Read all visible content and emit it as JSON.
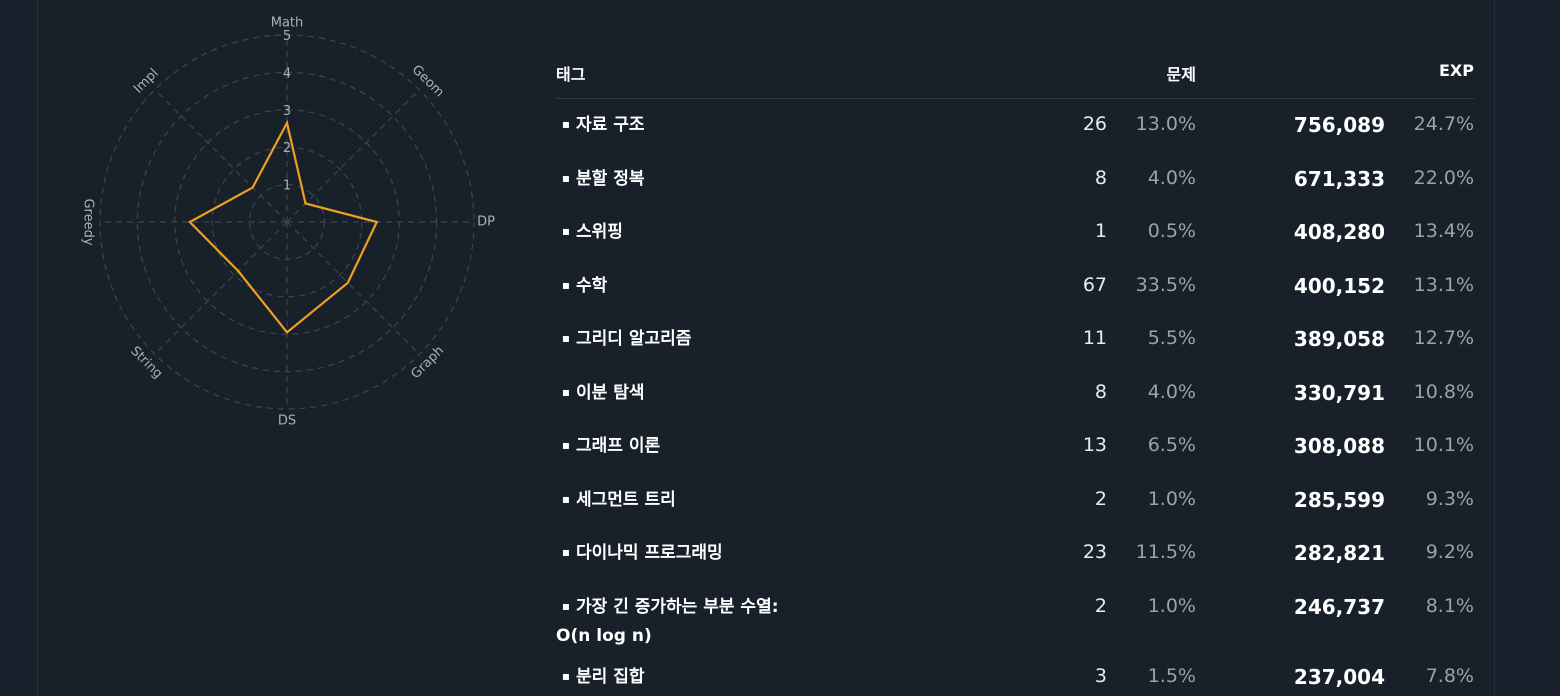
{
  "radar": {
    "axes": [
      "Math",
      "Geom",
      "DP",
      "Graph",
      "DS",
      "String",
      "Greedy",
      "Impl"
    ],
    "ticks": [
      "1",
      "2",
      "3",
      "4",
      "5"
    ],
    "values": [
      2.65,
      0.7,
      2.4,
      2.3,
      2.95,
      1.85,
      2.6,
      1.3
    ],
    "max": 5,
    "line_color": "#f0a020",
    "grid_color": "#3a4654"
  },
  "table": {
    "headers": {
      "tag": "태그",
      "problems": "문제",
      "exp": "EXP"
    },
    "rows": [
      {
        "tag": "자료 구조",
        "count": "26",
        "count_pct": "13.0%",
        "exp": "756,089",
        "exp_pct": "24.7%"
      },
      {
        "tag": "분할 정복",
        "count": "8",
        "count_pct": "4.0%",
        "exp": "671,333",
        "exp_pct": "22.0%"
      },
      {
        "tag": "스위핑",
        "count": "1",
        "count_pct": "0.5%",
        "exp": "408,280",
        "exp_pct": "13.4%"
      },
      {
        "tag": "수학",
        "count": "67",
        "count_pct": "33.5%",
        "exp": "400,152",
        "exp_pct": "13.1%"
      },
      {
        "tag": "그리디 알고리즘",
        "count": "11",
        "count_pct": "5.5%",
        "exp": "389,058",
        "exp_pct": "12.7%"
      },
      {
        "tag": "이분 탐색",
        "count": "8",
        "count_pct": "4.0%",
        "exp": "330,791",
        "exp_pct": "10.8%"
      },
      {
        "tag": "그래프 이론",
        "count": "13",
        "count_pct": "6.5%",
        "exp": "308,088",
        "exp_pct": "10.1%"
      },
      {
        "tag": "세그먼트 트리",
        "count": "2",
        "count_pct": "1.0%",
        "exp": "285,599",
        "exp_pct": "9.3%"
      },
      {
        "tag": "다이나믹 프로그래밍",
        "count": "23",
        "count_pct": "11.5%",
        "exp": "282,821",
        "exp_pct": "9.2%"
      },
      {
        "tag": "가장 긴 증가하는 부분 수열: O(n log n)",
        "count": "2",
        "count_pct": "1.0%",
        "exp": "246,737",
        "exp_pct": "8.1%"
      },
      {
        "tag": "분리 집합",
        "count": "3",
        "count_pct": "1.5%",
        "exp": "237,004",
        "exp_pct": "7.8%"
      }
    ]
  }
}
